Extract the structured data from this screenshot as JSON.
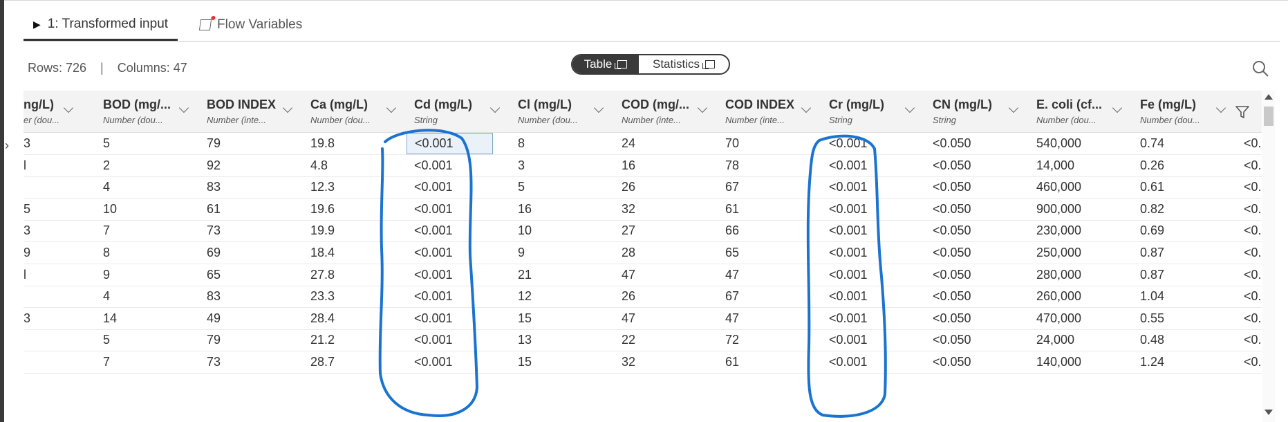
{
  "tabs": [
    {
      "label": "1: Transformed input",
      "icon": "play-icon",
      "active": true
    },
    {
      "label": "Flow Variables",
      "icon": "flow-variable-icon",
      "active": false
    }
  ],
  "info": {
    "rows": "Rows: 726",
    "separator": "|",
    "columns": "Columns: 47"
  },
  "view_toggle": {
    "table": "Table",
    "statistics": "Statistics",
    "selected": "Table"
  },
  "columns": [
    {
      "name": "ng/L)",
      "type": "er (dou..."
    },
    {
      "name": "BOD (mg/...",
      "type": "Number (dou..."
    },
    {
      "name": "BOD INDEX",
      "type": "Number (inte..."
    },
    {
      "name": "Ca (mg/L)",
      "type": "Number (dou..."
    },
    {
      "name": "Cd (mg/L)",
      "type": "String"
    },
    {
      "name": "Cl (mg/L)",
      "type": "Number (dou..."
    },
    {
      "name": "COD (mg/...",
      "type": "Number (inte..."
    },
    {
      "name": "COD INDEX",
      "type": "Number (inte..."
    },
    {
      "name": "Cr (mg/L)",
      "type": "String"
    },
    {
      "name": "CN (mg/L)",
      "type": "String"
    },
    {
      "name": "E. coli (cf...",
      "type": "Number (dou..."
    },
    {
      "name": "Fe (mg/L)",
      "type": "Number (dou..."
    }
  ],
  "rows": [
    [
      "3",
      "5",
      "79",
      "19.8",
      "<0.001",
      "8",
      "24",
      "70",
      "<0.001",
      "<0.050",
      "540,000",
      "0.74",
      "<0.0"
    ],
    [
      "l",
      "2",
      "92",
      "4.8",
      "<0.001",
      "3",
      "16",
      "78",
      "<0.001",
      "<0.050",
      "14,000",
      "0.26",
      "<0.0"
    ],
    [
      "",
      "4",
      "83",
      "12.3",
      "<0.001",
      "5",
      "26",
      "67",
      "<0.001",
      "<0.050",
      "460,000",
      "0.61",
      "<0.0"
    ],
    [
      "5",
      "10",
      "61",
      "19.6",
      "<0.001",
      "16",
      "32",
      "61",
      "<0.001",
      "<0.050",
      "900,000",
      "0.82",
      "<0.0"
    ],
    [
      "3",
      "7",
      "73",
      "19.9",
      "<0.001",
      "10",
      "27",
      "66",
      "<0.001",
      "<0.050",
      "230,000",
      "0.69",
      "<0.0"
    ],
    [
      "9",
      "8",
      "69",
      "18.4",
      "<0.001",
      "9",
      "28",
      "65",
      "<0.001",
      "<0.050",
      "250,000",
      "0.87",
      "<0.0"
    ],
    [
      "l",
      "9",
      "65",
      "27.8",
      "<0.001",
      "21",
      "47",
      "47",
      "<0.001",
      "<0.050",
      "280,000",
      "0.87",
      "<0.0"
    ],
    [
      "",
      "4",
      "83",
      "23.3",
      "<0.001",
      "12",
      "26",
      "67",
      "<0.001",
      "<0.050",
      "260,000",
      "1.04",
      "<0.0"
    ],
    [
      "3",
      "14",
      "49",
      "28.4",
      "<0.001",
      "15",
      "47",
      "47",
      "<0.001",
      "<0.050",
      "470,000",
      "0.55",
      "<0.0"
    ],
    [
      "",
      "5",
      "79",
      "21.2",
      "<0.001",
      "13",
      "22",
      "72",
      "<0.001",
      "<0.050",
      "24,000",
      "0.48",
      "<0.0"
    ],
    [
      "",
      "7",
      "73",
      "28.7",
      "<0.001",
      "15",
      "32",
      "61",
      "<0.001",
      "<0.050",
      "140,000",
      "1.24",
      "<0.0"
    ]
  ],
  "selected_cell": {
    "row": 0,
    "col": 4
  },
  "annotation": {
    "color": "#1a73d1"
  }
}
